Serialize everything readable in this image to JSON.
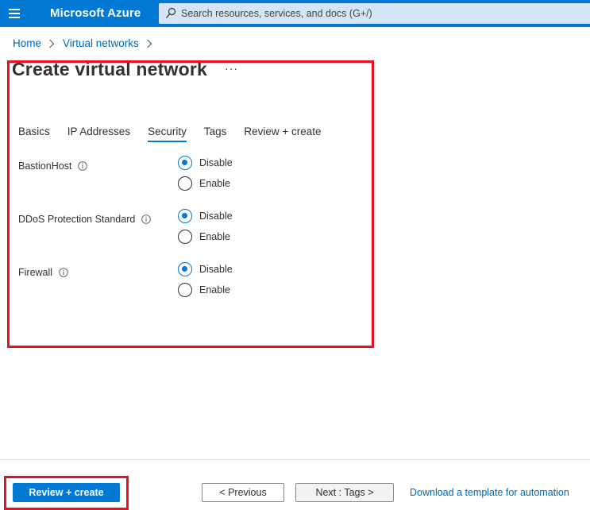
{
  "header": {
    "brand": "Microsoft Azure",
    "search_placeholder": "Search resources, services, and docs (G+/)",
    "menu_icon": "hamburger-icon",
    "search_icon": "search-icon",
    "color_accent": "#0078d4"
  },
  "breadcrumb": {
    "items": [
      "Home",
      "Virtual networks"
    ]
  },
  "page": {
    "title": "Create virtual network",
    "more_label": "···"
  },
  "tabs": [
    {
      "label": "Basics",
      "active": false
    },
    {
      "label": "IP Addresses",
      "active": false
    },
    {
      "label": "Security",
      "active": true
    },
    {
      "label": "Tags",
      "active": false
    },
    {
      "label": "Review + create",
      "active": false
    }
  ],
  "security": {
    "fields": [
      {
        "label": "BastionHost",
        "options": [
          "Disable",
          "Enable"
        ],
        "selected": "Disable"
      },
      {
        "label": "DDoS Protection Standard",
        "options": [
          "Disable",
          "Enable"
        ],
        "selected": "Disable"
      },
      {
        "label": "Firewall",
        "options": [
          "Disable",
          "Enable"
        ],
        "selected": "Disable"
      }
    ]
  },
  "footer": {
    "review_create": "Review + create",
    "previous": "< Previous",
    "next": "Next : Tags >",
    "download_link": "Download a template for automation"
  },
  "highlight_color": "#e81123"
}
